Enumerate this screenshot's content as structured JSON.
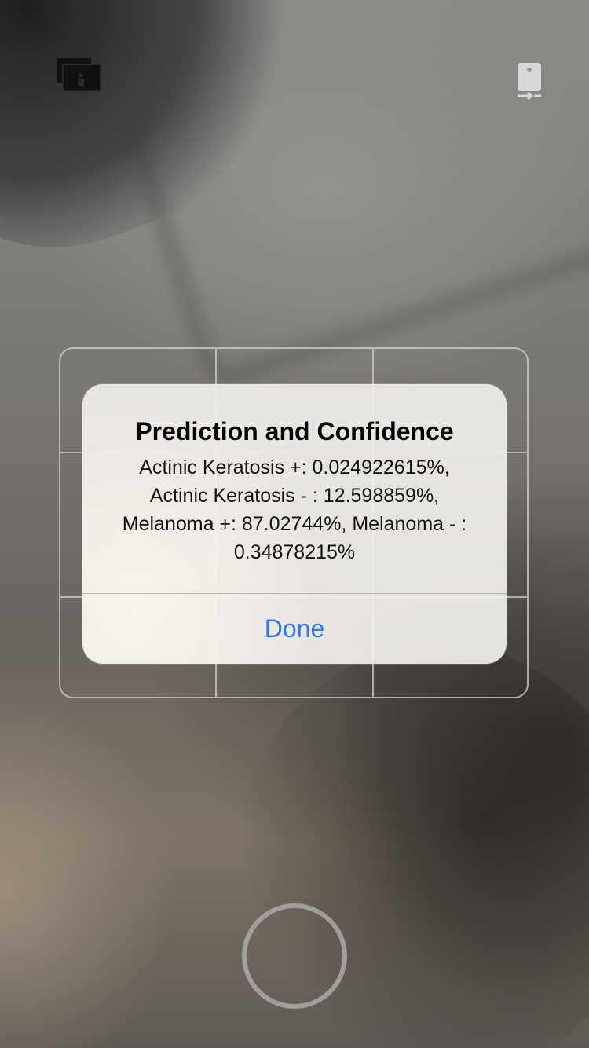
{
  "top_bar": {
    "left_icon": "photo-library-icon",
    "right_icon": "camera-switch-icon"
  },
  "alert": {
    "title": "Prediction and Confidence",
    "message_lines": [
      "Actinic Keratosis +: 0.024922615%,",
      "Actinic Keratosis - : 12.598859%,",
      "Melanoma +: 87.02744%, Melanoma - :",
      "0.34878215%"
    ],
    "button_label": "Done",
    "button_color": "#3478f6"
  },
  "controls": {
    "shutter_icon": "shutter-button-icon"
  }
}
